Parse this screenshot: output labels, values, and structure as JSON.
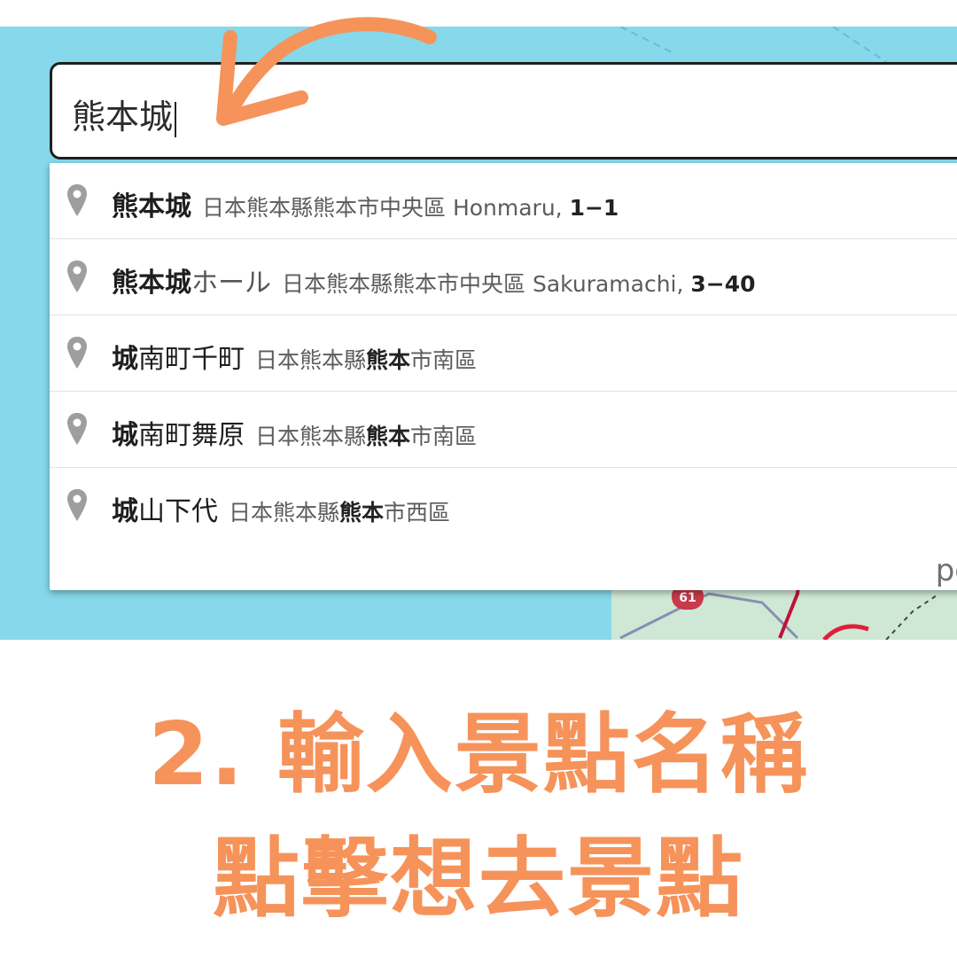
{
  "search": {
    "value": "熊本城"
  },
  "suggestions": [
    {
      "icon": "map-pin-icon",
      "main_bold": "熊本城",
      "main_rest": "",
      "secondary_before": "日本熊本縣熊本市中央區 Honmaru, ",
      "secondary_bold": "1−1",
      "secondary_after": ""
    },
    {
      "icon": "map-pin-icon",
      "main_bold": "熊本城",
      "main_rest": "ホール",
      "secondary_before": "日本熊本縣熊本市中央區 Sakuramachi, ",
      "secondary_bold": "3−40",
      "secondary_after": ""
    },
    {
      "icon": "map-pin-icon",
      "main_bold": "城",
      "main_rest": "南町千町",
      "secondary_before": "日本熊本縣",
      "secondary_bold": "熊本",
      "secondary_after": "市南區"
    },
    {
      "icon": "map-pin-icon",
      "main_bold": "城",
      "main_rest": "南町舞原",
      "secondary_before": "日本熊本縣",
      "secondary_bold": "熊本",
      "secondary_after": "市南區"
    },
    {
      "icon": "map-pin-icon",
      "main_bold": "城",
      "main_rest": "山下代",
      "secondary_before": "日本熊本縣",
      "secondary_bold": "熊本",
      "secondary_after": "市西區"
    }
  ],
  "powered_by": "pc",
  "map": {
    "route_shield": "61"
  },
  "caption": {
    "line1": "2. 輸入景點名稱",
    "line2": "點擊想去景點"
  },
  "colors": {
    "accent_orange": "#f6935a",
    "map_water": "#86d8ea"
  }
}
